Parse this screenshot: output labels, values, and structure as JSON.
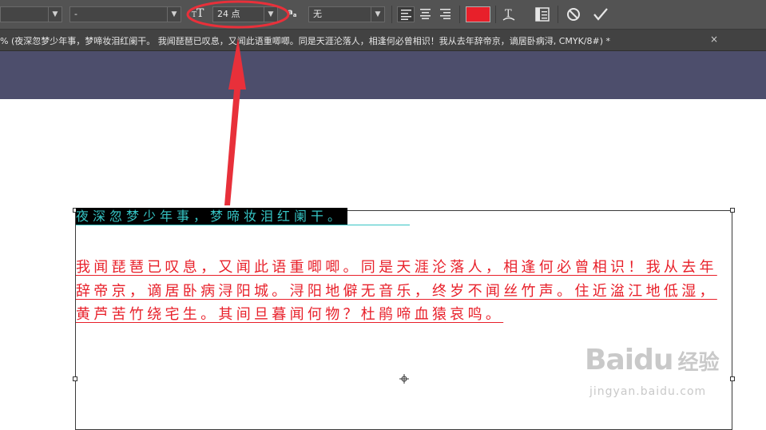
{
  "options_bar": {
    "font_style_value": "-",
    "font_size_value": "24 点",
    "anti_alias_value": "无",
    "text_color": "#e8202a"
  },
  "document_tab": {
    "title": "% (夜深忽梦少年事，梦啼妆泪红阑干。  我闻琵琶已叹息，又闻此语重唧唧。同是天涯沦落人，相逢何必曾相识！我从去年辞帝京，谪居卧病浔, CMYK/8#) *",
    "close_glyph": "×"
  },
  "canvas": {
    "heading_line": "夜深忽梦少年事，梦啼妆泪红阑干。",
    "paragraph": "我闻琵琶已叹息，又闻此语重唧唧。同是天涯沦落人，相逢何必曾相识！我从去年辞帝京，谪居卧病浔阳城。浔阳地僻无音乐，终岁不闻丝竹声。住近湓江地低湿，黄芦苦竹绕宅生。其间旦暮闻何物？杜鹃啼血猿哀鸣。"
  },
  "watermark": {
    "brand": "Bai",
    "brand_du": "du",
    "brand_cn": "经验",
    "url": "jingyan.baidu.com"
  },
  "icons": [
    "chevron-down-icon",
    "text-size-icon",
    "anti-alias-icon",
    "align-left-icon",
    "align-center-icon",
    "align-right-icon",
    "warp-text-icon",
    "character-panel-icon",
    "cancel-icon",
    "commit-check-icon",
    "close-icon",
    "crosshair-icon"
  ],
  "colors": {
    "annotation": "#e8303a",
    "heading_text": "#36c4c4",
    "pasteboard": "#4d4e6c"
  }
}
